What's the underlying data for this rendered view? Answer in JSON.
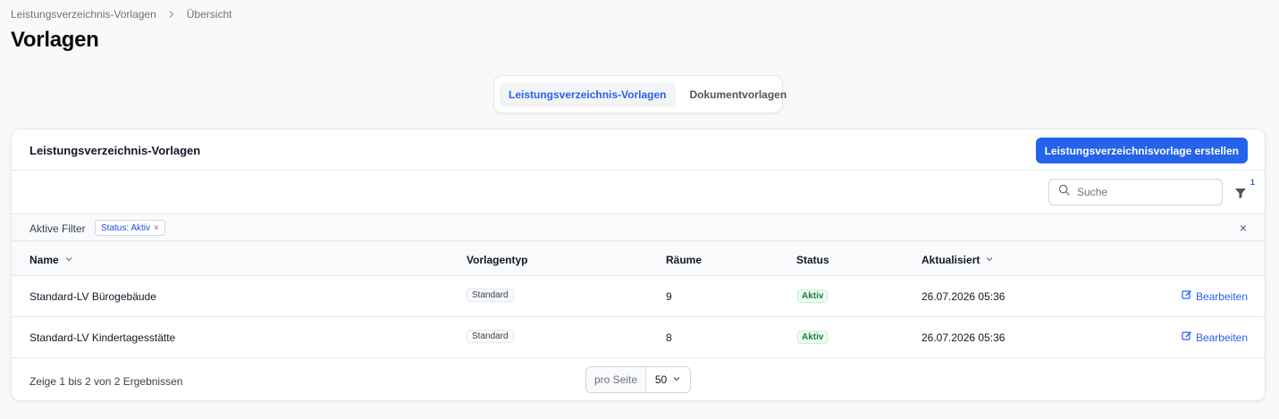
{
  "breadcrumb": {
    "items": [
      "Leistungsverzeichnis-Vorlagen",
      "Übersicht"
    ]
  },
  "page_title": "Vorlagen",
  "tabs": [
    {
      "label": "Leistungsverzeichnis-Vorlagen",
      "active": true
    },
    {
      "label": "Dokumentvorlagen",
      "active": false
    }
  ],
  "card": {
    "title": "Leistungsverzeichnis-Vorlagen",
    "create_button": "Leistungsverzeichnisvorlage erstellen"
  },
  "search": {
    "placeholder": "Suche",
    "value": ""
  },
  "filter": {
    "count": "1",
    "active_label": "Aktive Filter",
    "chip": "Status: Aktiv",
    "chip_remove": "×",
    "clear": "×"
  },
  "table": {
    "columns": [
      "Name",
      "Vorlagentyp",
      "Räume",
      "Status",
      "Aktualisiert"
    ],
    "rows": [
      {
        "name": "Standard-LV Bürogebäude",
        "type": "Standard",
        "rooms": "9",
        "status": "Aktiv",
        "updated": "26.07.2026 05:36",
        "action": "Bearbeiten"
      },
      {
        "name": "Standard-LV Kindertagesstätte",
        "type": "Standard",
        "rooms": "8",
        "status": "Aktiv",
        "updated": "26.07.2026 05:36",
        "action": "Bearbeiten"
      }
    ]
  },
  "pagination": {
    "summary": "Zeige 1 bis 2 von 2 Ergebnissen",
    "per_page_label": "pro Seite",
    "per_page_value": "50"
  },
  "colors": {
    "accent": "#2563eb",
    "status_green": "#15803d",
    "border": "#e5e7eb"
  }
}
